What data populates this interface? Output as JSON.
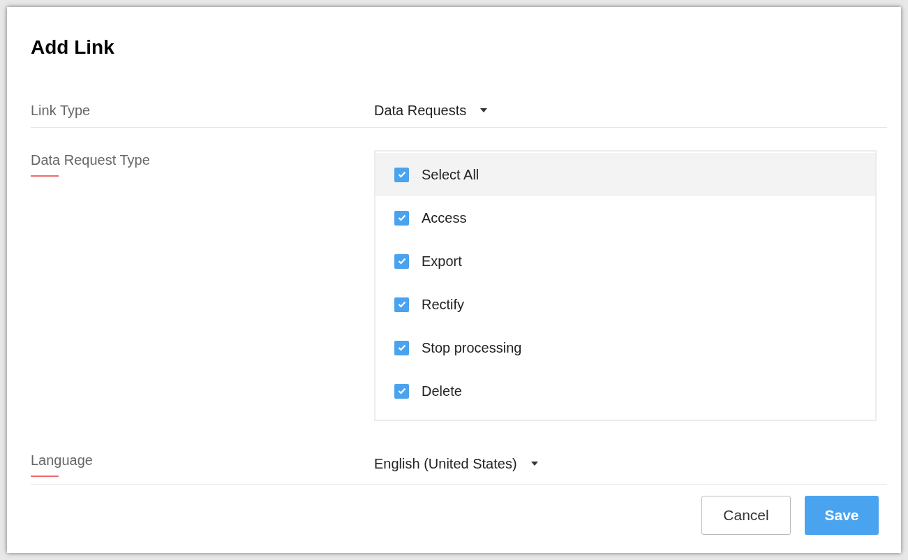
{
  "dialog": {
    "title": "Add Link"
  },
  "fields": [
    {
      "kind": "dropdown",
      "label": "Link Type",
      "required": false,
      "value": "Data Requests"
    },
    {
      "kind": "checklist",
      "label": "Data Request Type",
      "required": true,
      "options": [
        {
          "kind": "select_all",
          "label": "Select All",
          "checked": true
        },
        {
          "kind": "option",
          "label": "Access",
          "checked": true
        },
        {
          "kind": "option",
          "label": "Export",
          "checked": true
        },
        {
          "kind": "option",
          "label": "Rectify",
          "checked": true
        },
        {
          "kind": "option",
          "label": "Stop processing",
          "checked": true
        },
        {
          "kind": "option",
          "label": "Delete",
          "checked": true
        }
      ]
    },
    {
      "kind": "dropdown",
      "label": "Language",
      "required": true,
      "value": "English (United States)"
    }
  ],
  "buttons": [
    {
      "kind": "secondary",
      "label": "Cancel"
    },
    {
      "kind": "primary",
      "label": "Save"
    }
  ]
}
